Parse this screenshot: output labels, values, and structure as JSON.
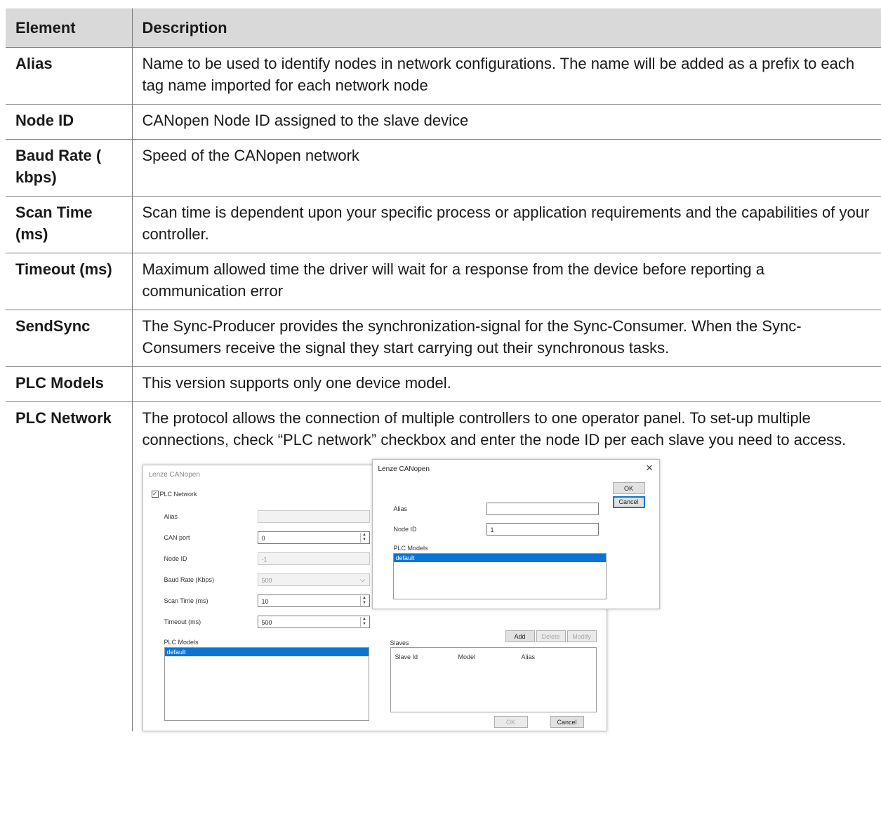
{
  "table": {
    "headers": [
      "Element",
      "Description"
    ],
    "rows": [
      {
        "element": "Alias",
        "description": "Name to be used to identify nodes in network configurations. The name will be added as a prefix to each tag name imported for each network node"
      },
      {
        "element": "Node ID",
        "description": "CANopen Node ID assigned to the slave device"
      },
      {
        "element": "Baud Rate ( kbps)",
        "description": "Speed of the CANopen network"
      },
      {
        "element": "Scan Time (ms)",
        "description": "Scan time is dependent upon your specific process or application requirements and the capabilities of your controller."
      },
      {
        "element": "Timeout (ms)",
        "description": "Maximum allowed time the driver will wait for a response from the device before reporting a communication error"
      },
      {
        "element": "SendSync",
        "description": "The Sync-Producer provides the synchronization-signal for the Sync-Consumer. When the Sync-Consumers receive the signal they start carrying out their synchronous tasks."
      },
      {
        "element": "PLC Models",
        "description": "This version supports only one device model."
      },
      {
        "element": "PLC Network",
        "description": "The protocol allows the connection of multiple controllers to one operator panel. To set-up multiple connections, check “PLC network” checkbox and enter the node ID per each slave you need to access."
      }
    ]
  },
  "screenshot": {
    "main": {
      "title": "Lenze CANopen",
      "plc_network_label": "PLC Network",
      "alias_label": "Alias",
      "can_port_label": "CAN port",
      "can_port_value": "0",
      "node_id_label": "Node ID",
      "node_id_value": "-1",
      "baud_label": "Baud Rate (Kbps)",
      "baud_value": "500",
      "scan_label": "Scan Time (ms)",
      "scan_value": "10",
      "timeout_label": "Timeout (ms)",
      "timeout_value": "500",
      "plc_models_label": "PLC Models",
      "selected_model": "default",
      "slaves_label": "Slaves",
      "add_label": "Add",
      "delete_label": "Delete",
      "modify_label": "Modify",
      "col_slave_id": "Slave Id",
      "col_model": "Model",
      "col_alias": "Alias",
      "ok_label": "OK",
      "cancel_label": "Cancel"
    },
    "popup": {
      "title": "Lenze CANopen",
      "close_glyph": "✕",
      "ok_label": "OK",
      "cancel_label": "Cancel",
      "alias_label": "Alias",
      "alias_value": "",
      "node_id_label": "Node ID",
      "node_id_value": "1",
      "plc_models_label": "PLC Models",
      "selected_model": "default"
    }
  }
}
